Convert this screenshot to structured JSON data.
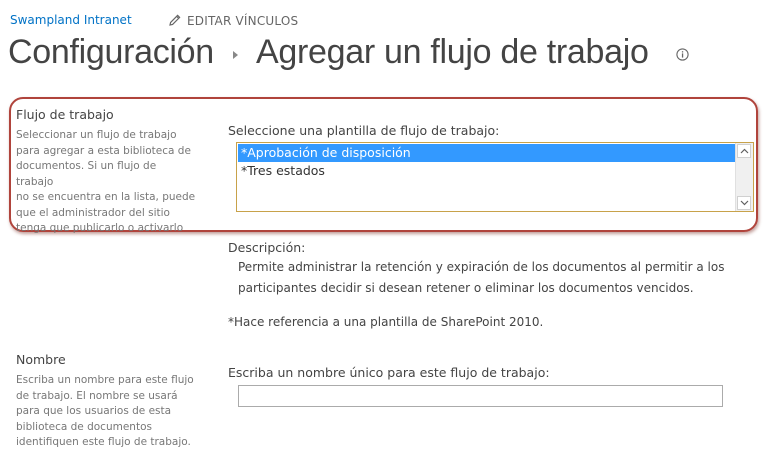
{
  "header": {
    "site_name": "Swampland Intranet",
    "edit_links_label": "EDITAR VÍNCULOS"
  },
  "title": {
    "breadcrumb": "Configuración",
    "current": "Agregar un flujo de trabajo"
  },
  "workflow_section": {
    "title": "Flujo de trabajo",
    "description_lines": [
      "Seleccionar un flujo de trabajo",
      "para agregar a esta biblioteca de",
      "documentos. Si un flujo de trabajo",
      "no se encuentra en la lista, puede",
      "que el administrador del sitio",
      "tenga que publicarlo o activarlo"
    ],
    "select_label": "Seleccione una plantilla de flujo de trabajo:",
    "templates": [
      {
        "label": "*Aprobación de disposición",
        "selected": true
      },
      {
        "label": "*Tres estados",
        "selected": false
      }
    ],
    "description_label": "Descripción:",
    "description_lines_main": [
      "Permite administrar la retención y expiración de los documentos al permitir a los",
      "participantes decidir si desean retener o eliminar los documentos vencidos."
    ],
    "footnote": "*Hace referencia a una plantilla de SharePoint 2010."
  },
  "name_section": {
    "title": "Nombre",
    "description_lines": [
      "Escriba un nombre para este flujo",
      "de trabajo. El nombre se usará",
      "para que los usuarios de esta",
      "biblioteca de documentos",
      "identifiquen este flujo de trabajo."
    ],
    "input_label": "Escriba un nombre único para este flujo de trabajo:",
    "input_value": ""
  },
  "colors": {
    "link": "#0072c6",
    "highlight_border": "#b0443c",
    "selection": "#3399ff",
    "listbox_border": "#c8a24a"
  },
  "icons": [
    "pencil-icon",
    "info-icon",
    "scroll-up-icon",
    "scroll-down-icon",
    "breadcrumb-separator-icon"
  ]
}
